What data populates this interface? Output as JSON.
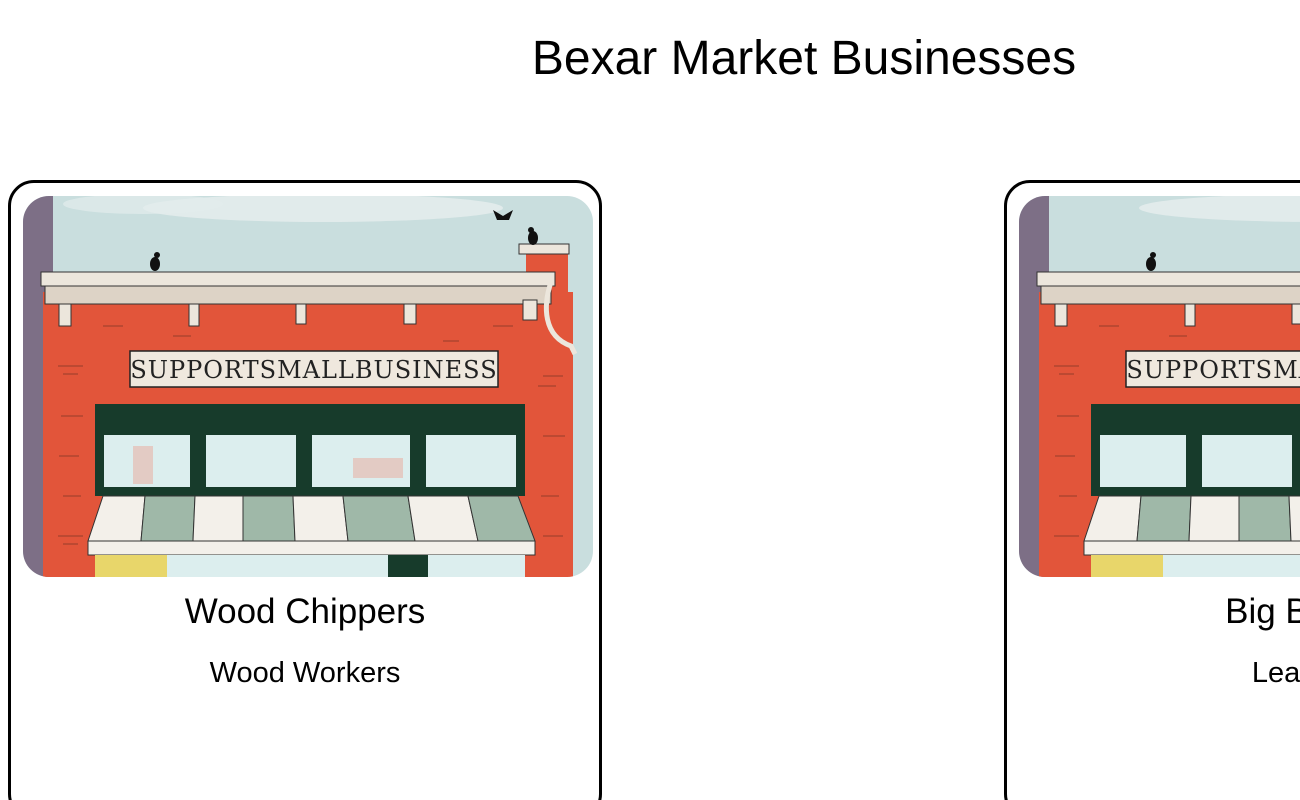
{
  "page": {
    "title": "Bexar Market Businesses"
  },
  "image_text": "SUPPORT SMALL BUSINESS",
  "businesses": [
    {
      "name": "Wood Chippers",
      "category": "Wood Workers"
    },
    {
      "name": "Big Bexar",
      "category": "Leather"
    }
  ],
  "colors": {
    "sky": "#c9dede",
    "brick": "#e2553a",
    "cornice": "#ece6dc",
    "window_frame": "#173b2b",
    "awning_green": "#9fb8a8",
    "awning_white": "#f3f0ea",
    "side_wall": "#7d6f86"
  }
}
